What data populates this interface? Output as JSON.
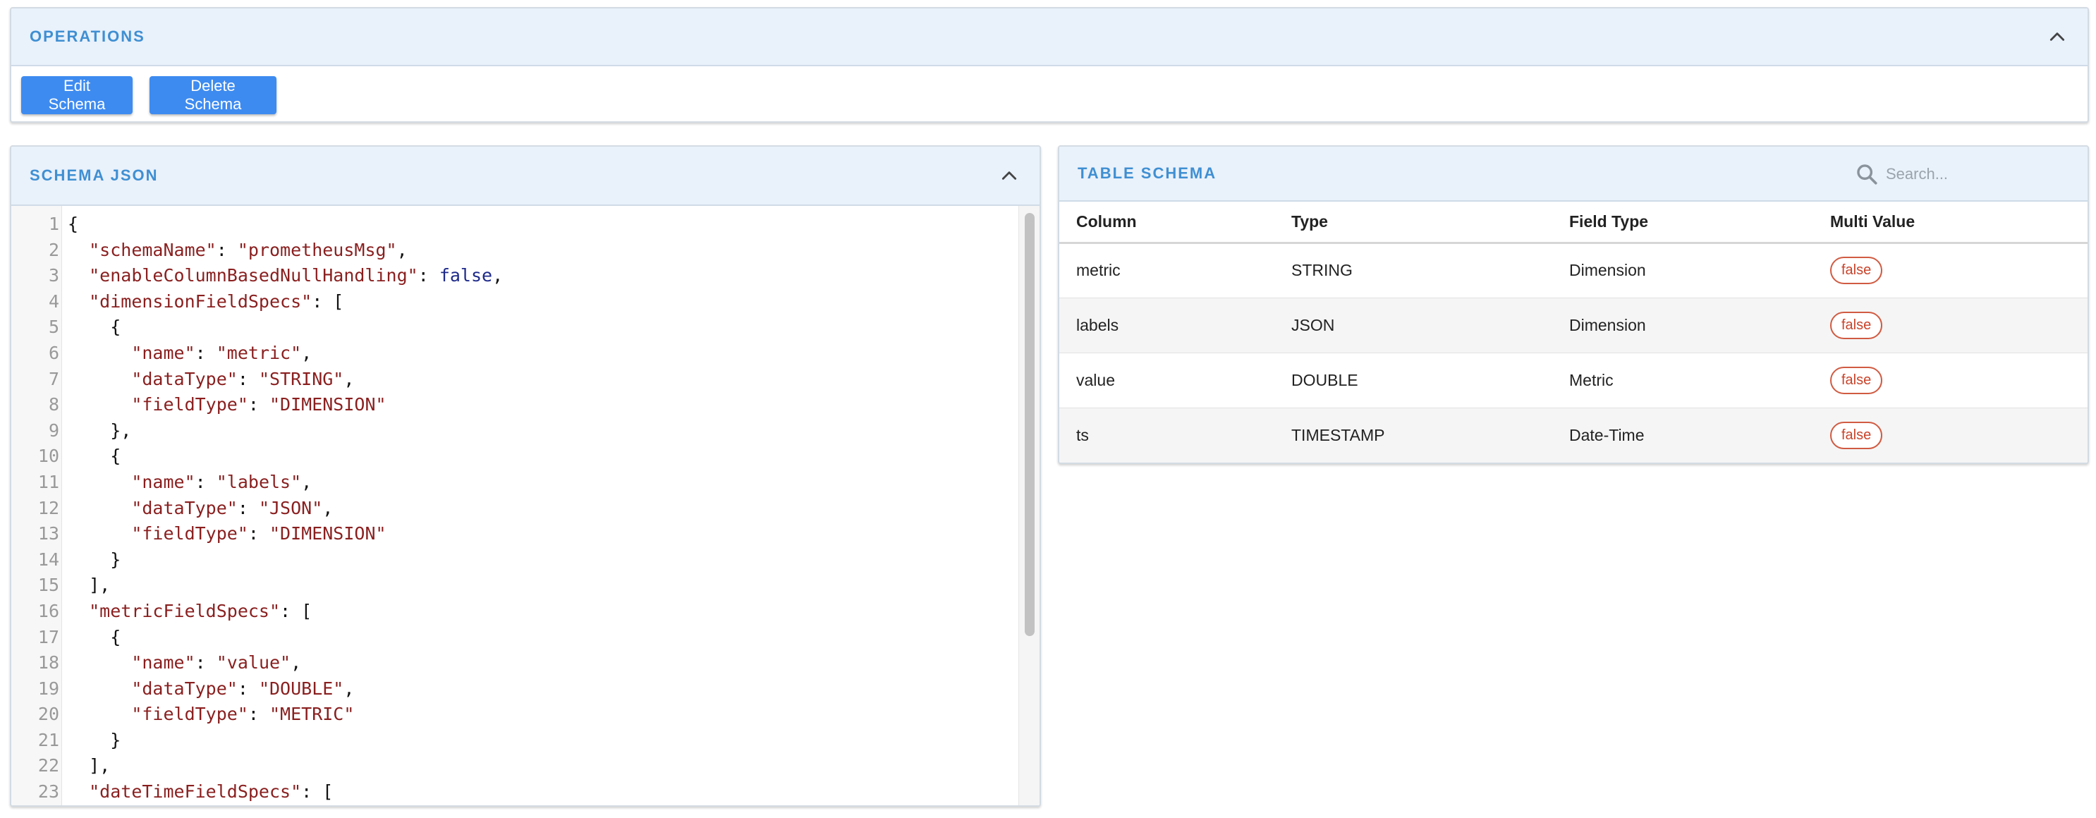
{
  "operations": {
    "title": "OPERATIONS",
    "buttons": {
      "edit": "Edit Schema",
      "delete": "Delete Schema"
    }
  },
  "schema_json": {
    "title": "SCHEMA JSON",
    "lines": [
      [
        [
          "p",
          "{"
        ]
      ],
      [
        [
          "p",
          "  "
        ],
        [
          "s",
          "\"schemaName\""
        ],
        [
          "p",
          ": "
        ],
        [
          "s",
          "\"prometheusMsg\""
        ],
        [
          "p",
          ","
        ]
      ],
      [
        [
          "p",
          "  "
        ],
        [
          "s",
          "\"enableColumnBasedNullHandling\""
        ],
        [
          "p",
          ": "
        ],
        [
          "k",
          "false"
        ],
        [
          "p",
          ","
        ]
      ],
      [
        [
          "p",
          "  "
        ],
        [
          "s",
          "\"dimensionFieldSpecs\""
        ],
        [
          "p",
          ": ["
        ]
      ],
      [
        [
          "p",
          "    {"
        ]
      ],
      [
        [
          "p",
          "      "
        ],
        [
          "s",
          "\"name\""
        ],
        [
          "p",
          ": "
        ],
        [
          "s",
          "\"metric\""
        ],
        [
          "p",
          ","
        ]
      ],
      [
        [
          "p",
          "      "
        ],
        [
          "s",
          "\"dataType\""
        ],
        [
          "p",
          ": "
        ],
        [
          "s",
          "\"STRING\""
        ],
        [
          "p",
          ","
        ]
      ],
      [
        [
          "p",
          "      "
        ],
        [
          "s",
          "\"fieldType\""
        ],
        [
          "p",
          ": "
        ],
        [
          "s",
          "\"DIMENSION\""
        ]
      ],
      [
        [
          "p",
          "    },"
        ]
      ],
      [
        [
          "p",
          "    {"
        ]
      ],
      [
        [
          "p",
          "      "
        ],
        [
          "s",
          "\"name\""
        ],
        [
          "p",
          ": "
        ],
        [
          "s",
          "\"labels\""
        ],
        [
          "p",
          ","
        ]
      ],
      [
        [
          "p",
          "      "
        ],
        [
          "s",
          "\"dataType\""
        ],
        [
          "p",
          ": "
        ],
        [
          "s",
          "\"JSON\""
        ],
        [
          "p",
          ","
        ]
      ],
      [
        [
          "p",
          "      "
        ],
        [
          "s",
          "\"fieldType\""
        ],
        [
          "p",
          ": "
        ],
        [
          "s",
          "\"DIMENSION\""
        ]
      ],
      [
        [
          "p",
          "    }"
        ]
      ],
      [
        [
          "p",
          "  ],"
        ]
      ],
      [
        [
          "p",
          "  "
        ],
        [
          "s",
          "\"metricFieldSpecs\""
        ],
        [
          "p",
          ": ["
        ]
      ],
      [
        [
          "p",
          "    {"
        ]
      ],
      [
        [
          "p",
          "      "
        ],
        [
          "s",
          "\"name\""
        ],
        [
          "p",
          ": "
        ],
        [
          "s",
          "\"value\""
        ],
        [
          "p",
          ","
        ]
      ],
      [
        [
          "p",
          "      "
        ],
        [
          "s",
          "\"dataType\""
        ],
        [
          "p",
          ": "
        ],
        [
          "s",
          "\"DOUBLE\""
        ],
        [
          "p",
          ","
        ]
      ],
      [
        [
          "p",
          "      "
        ],
        [
          "s",
          "\"fieldType\""
        ],
        [
          "p",
          ": "
        ],
        [
          "s",
          "\"METRIC\""
        ]
      ],
      [
        [
          "p",
          "    }"
        ]
      ],
      [
        [
          "p",
          "  ],"
        ]
      ],
      [
        [
          "p",
          "  "
        ],
        [
          "s",
          "\"dateTimeFieldSpecs\""
        ],
        [
          "p",
          ": ["
        ]
      ]
    ]
  },
  "table_schema": {
    "title": "TABLE SCHEMA",
    "search_placeholder": "Search...",
    "columns": [
      "Column",
      "Type",
      "Field Type",
      "Multi Value"
    ],
    "rows": [
      [
        "metric",
        "STRING",
        "Dimension",
        "false"
      ],
      [
        "labels",
        "JSON",
        "Dimension",
        "false"
      ],
      [
        "value",
        "DOUBLE",
        "Metric",
        "false"
      ],
      [
        "ts",
        "TIMESTAMP",
        "Date-Time",
        "false"
      ]
    ]
  },
  "colors": {
    "accent": "#3f8fd2",
    "button": "#3d8bf0",
    "header_bg": "#e9f1fb",
    "chip": "#c9432a",
    "json_string": "#8a1f1f",
    "json_keyword": "#1e2a8a"
  },
  "icons": {
    "collapse": "chevron-up-icon",
    "search": "search-icon"
  }
}
